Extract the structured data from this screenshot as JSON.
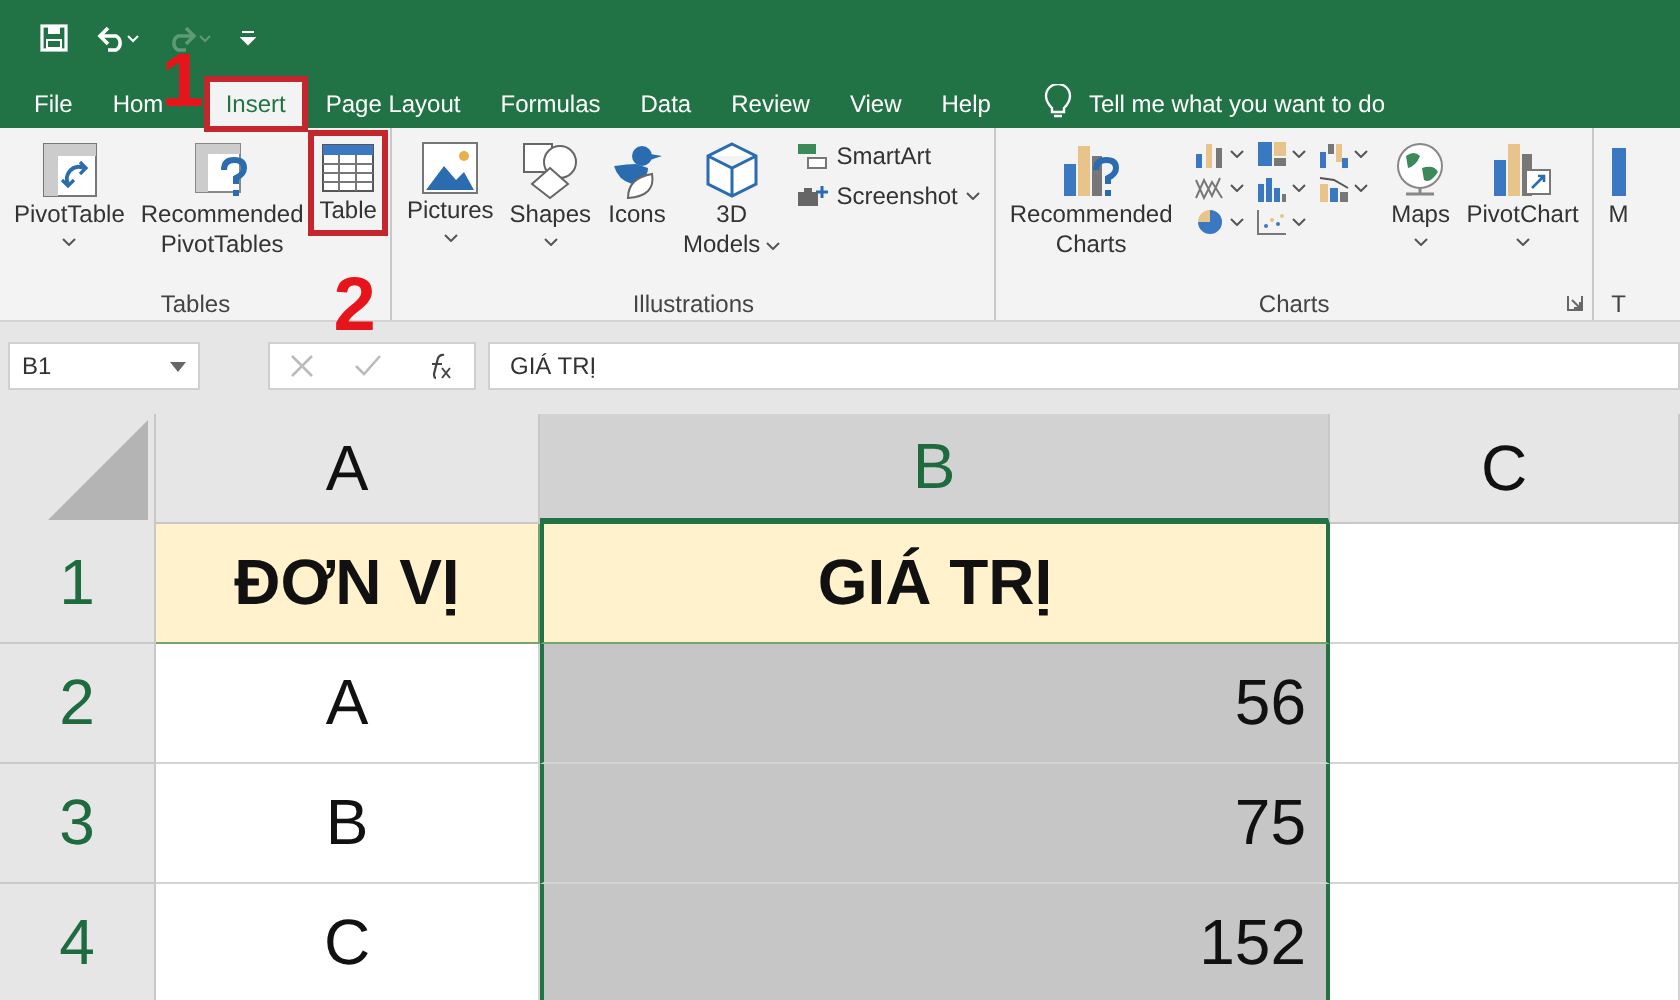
{
  "quick_access": [
    {
      "kind": "save",
      "disabled": false
    },
    {
      "kind": "undo",
      "disabled": false
    },
    {
      "kind": "redo",
      "disabled": true
    },
    {
      "kind": "customize",
      "disabled": false
    }
  ],
  "tabs": [
    {
      "label": "File",
      "selected": false
    },
    {
      "label": "Hom",
      "selected": false
    },
    {
      "label": "Insert",
      "selected": true,
      "highlighted": true
    },
    {
      "label": "Page Layout",
      "selected": false
    },
    {
      "label": "Formulas",
      "selected": false
    },
    {
      "label": "Data",
      "selected": false
    },
    {
      "label": "Review",
      "selected": false
    },
    {
      "label": "View",
      "selected": false
    },
    {
      "label": "Help",
      "selected": false
    }
  ],
  "tell_me": {
    "placeholder": "Tell me what you want to do"
  },
  "ribbon_groups": [
    {
      "label": "Tables",
      "items": [
        {
          "kind": "large",
          "lines": [
            "PivotTable"
          ],
          "caret": true
        },
        {
          "kind": "large",
          "lines": [
            "Recommended",
            "PivotTables"
          ]
        },
        {
          "kind": "large",
          "lines": [
            "Table"
          ],
          "highlighted": true
        }
      ]
    },
    {
      "label": "Illustrations",
      "items": [
        {
          "kind": "large",
          "lines": [
            "Pictures"
          ],
          "caret": true
        },
        {
          "kind": "large",
          "lines": [
            "Shapes"
          ],
          "caret": true
        },
        {
          "kind": "large",
          "lines": [
            "Icons"
          ]
        },
        {
          "kind": "large",
          "lines": [
            "3D",
            "Models"
          ],
          "caret": true
        },
        {
          "kind": "small",
          "lines": [
            "SmartArt"
          ]
        },
        {
          "kind": "small",
          "lines": [
            "Screenshot"
          ],
          "caret": true
        }
      ]
    },
    {
      "label": "Charts",
      "launcher": true,
      "items": [
        {
          "kind": "large",
          "lines": [
            "Recommended",
            "Charts"
          ]
        },
        {
          "kind": "gallery"
        },
        {
          "kind": "large",
          "lines": [
            "Maps"
          ],
          "caret": true
        },
        {
          "kind": "large",
          "lines": [
            "PivotChart"
          ],
          "caret": true
        }
      ]
    },
    {
      "label": "T",
      "items": [
        {
          "kind": "large",
          "lines": [
            "M"
          ]
        }
      ]
    }
  ],
  "annotations": [
    {
      "text": "1"
    },
    {
      "text": "2"
    }
  ],
  "formula_bar": {
    "name_box": "B1",
    "formula": "GIÁ TRỊ"
  },
  "grid": {
    "columns": [
      {
        "label": "A",
        "selected": false
      },
      {
        "label": "B",
        "selected": true
      },
      {
        "label": "C",
        "selected": false
      }
    ],
    "rows": [
      {
        "label": "1",
        "kind": "header",
        "cells": [
          {
            "text": "ĐƠN VỊ",
            "kind": "text"
          },
          {
            "text": "GIÁ TRỊ",
            "kind": "text"
          }
        ]
      },
      {
        "label": "2",
        "kind": "data",
        "cells": [
          {
            "text": "A",
            "kind": "text"
          },
          {
            "text": "56",
            "kind": "number"
          }
        ]
      },
      {
        "label": "3",
        "kind": "data",
        "cells": [
          {
            "text": "B",
            "kind": "text"
          },
          {
            "text": "75",
            "kind": "number"
          }
        ]
      },
      {
        "label": "4",
        "kind": "data",
        "cells": [
          {
            "text": "C",
            "kind": "text"
          },
          {
            "text": "152",
            "kind": "number"
          }
        ]
      }
    ]
  }
}
